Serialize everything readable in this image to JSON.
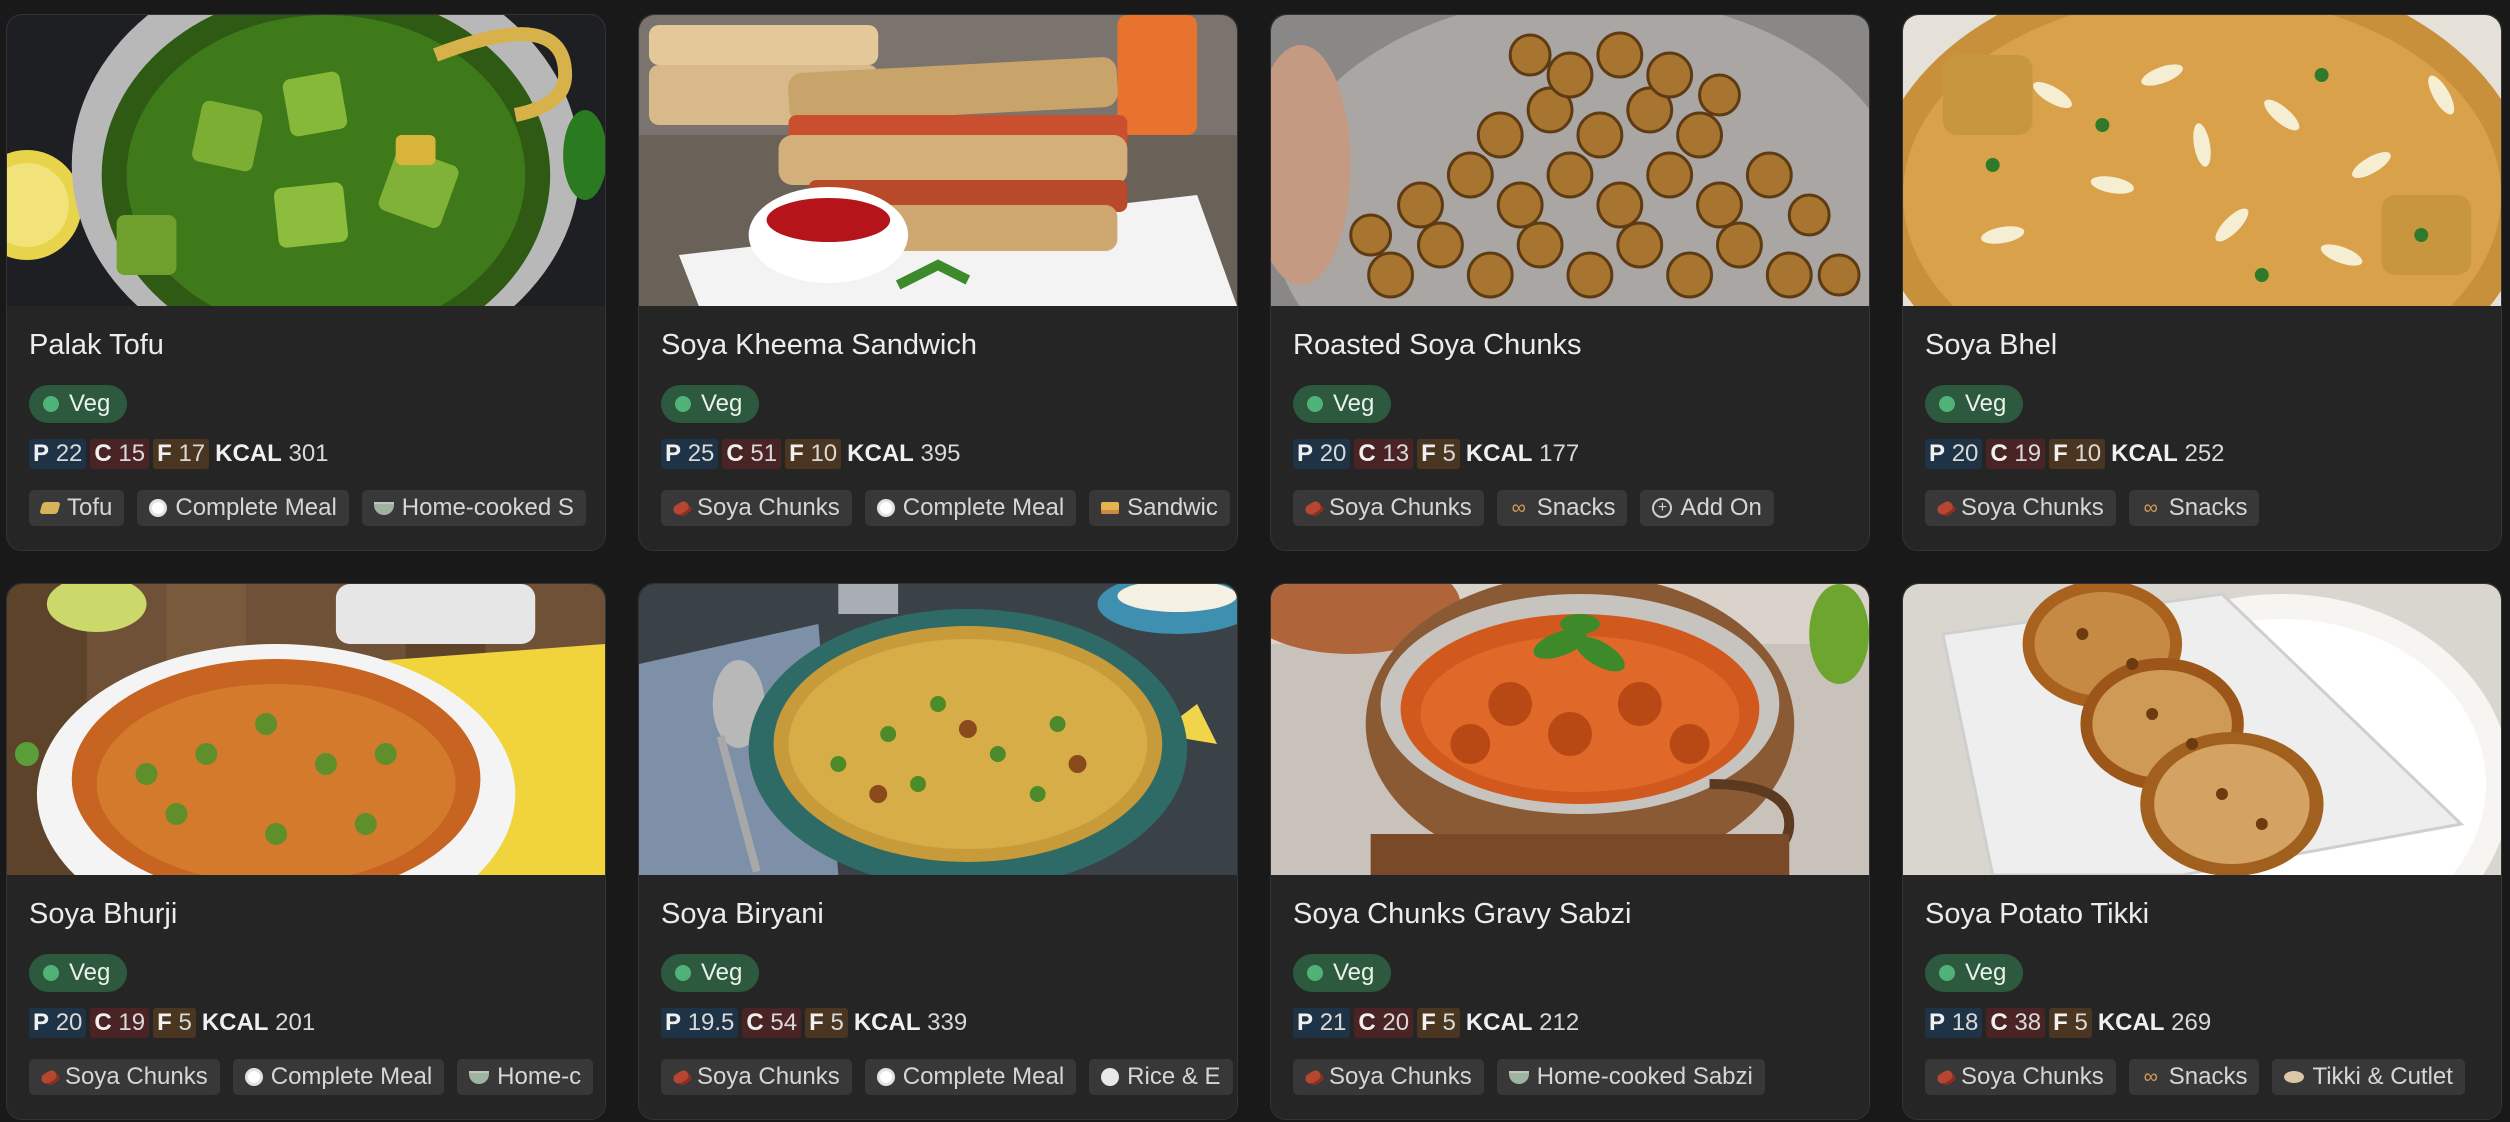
{
  "gallery": {
    "cards": [
      {
        "title": "Palak Tofu",
        "badge": "Veg",
        "macros": {
          "p": "22",
          "c": "15",
          "f": "17",
          "kcal": "301"
        },
        "tags": [
          {
            "label": "Tofu",
            "icon": "tofu-icon"
          },
          {
            "label": "Complete Meal",
            "icon": "plate-icon"
          },
          {
            "label": "Home-cooked S",
            "icon": "bowl-icon"
          }
        ]
      },
      {
        "title": "Soya Kheema Sandwich",
        "badge": "Veg",
        "macros": {
          "p": "25",
          "c": "51",
          "f": "10",
          "kcal": "395"
        },
        "tags": [
          {
            "label": "Soya Chunks",
            "icon": "soya-icon"
          },
          {
            "label": "Complete Meal",
            "icon": "plate-icon"
          },
          {
            "label": "Sandwic",
            "icon": "sandwich-icon"
          }
        ]
      },
      {
        "title": "Roasted Soya Chunks",
        "badge": "Veg",
        "macros": {
          "p": "20",
          "c": "13",
          "f": "5",
          "kcal": "177"
        },
        "tags": [
          {
            "label": "Soya Chunks",
            "icon": "soya-icon"
          },
          {
            "label": "Snacks",
            "icon": "pretzel-icon"
          },
          {
            "label": "Add On",
            "icon": "plus-circle-icon"
          }
        ]
      },
      {
        "title": "Soya Bhel",
        "badge": "Veg",
        "macros": {
          "p": "20",
          "c": "19",
          "f": "10",
          "kcal": "252"
        },
        "tags": [
          {
            "label": "Soya Chunks",
            "icon": "soya-icon"
          },
          {
            "label": "Snacks",
            "icon": "pretzel-icon"
          }
        ]
      },
      {
        "title": "Soya Bhurji",
        "badge": "Veg",
        "macros": {
          "p": "20",
          "c": "19",
          "f": "5",
          "kcal": "201"
        },
        "tags": [
          {
            "label": "Soya Chunks",
            "icon": "soya-icon"
          },
          {
            "label": "Complete Meal",
            "icon": "plate-icon"
          },
          {
            "label": "Home-c",
            "icon": "bowl-icon"
          }
        ]
      },
      {
        "title": "Soya Biryani",
        "badge": "Veg",
        "macros": {
          "p": "19.5",
          "c": "54",
          "f": "5",
          "kcal": "339"
        },
        "tags": [
          {
            "label": "Soya Chunks",
            "icon": "soya-icon"
          },
          {
            "label": "Complete Meal",
            "icon": "plate-icon"
          },
          {
            "label": "Rice & E",
            "icon": "rice-icon"
          }
        ]
      },
      {
        "title": "Soya Chunks Gravy Sabzi",
        "badge": "Veg",
        "macros": {
          "p": "21",
          "c": "20",
          "f": "5",
          "kcal": "212"
        },
        "tags": [
          {
            "label": "Soya Chunks",
            "icon": "soya-icon"
          },
          {
            "label": "Home-cooked Sabzi",
            "icon": "bowl-icon"
          }
        ]
      },
      {
        "title": "Soya Potato Tikki",
        "badge": "Veg",
        "macros": {
          "p": "18",
          "c": "38",
          "f": "5",
          "kcal": "269"
        },
        "tags": [
          {
            "label": "Soya Chunks",
            "icon": "soya-icon"
          },
          {
            "label": "Snacks",
            "icon": "pretzel-icon"
          },
          {
            "label": "Tikki & Cutlet",
            "icon": "tikki-icon"
          }
        ]
      }
    ]
  },
  "macro_labels": {
    "p": "P",
    "c": "C",
    "f": "F",
    "kcal": "KCAL"
  },
  "colors": {
    "page_bg": "#191919",
    "card_bg": "#252525",
    "veg_badge": "#2d5a3e",
    "veg_dot": "#4fb276",
    "protein_bg": "#1e3446",
    "carb_bg": "#4a2424",
    "fat_bg": "#4a3620",
    "tag_bg": "#383838"
  }
}
